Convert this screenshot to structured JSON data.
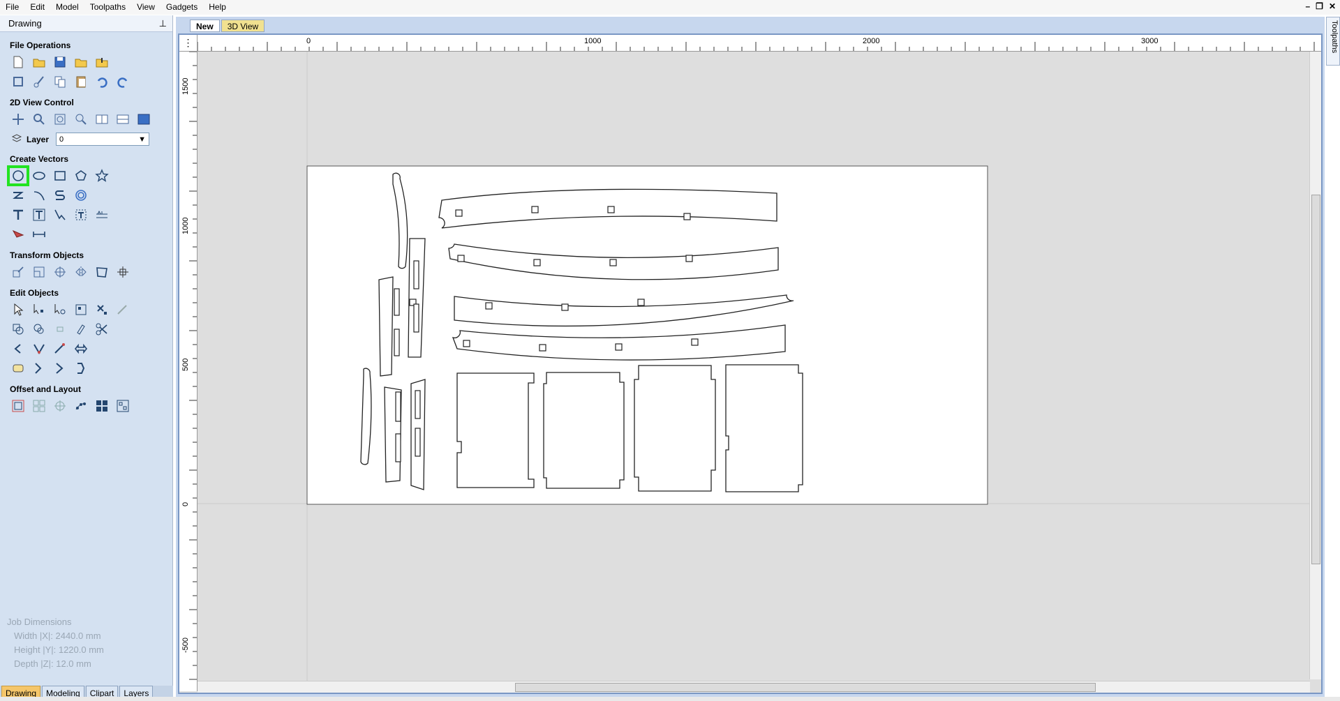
{
  "menu": [
    "File",
    "Edit",
    "Model",
    "Toolpaths",
    "View",
    "Gadgets",
    "Help"
  ],
  "panel": {
    "title": "Drawing",
    "sections": {
      "file_ops": "File Operations",
      "view_control": "2D View Control",
      "create_vectors": "Create Vectors",
      "transform": "Transform Objects",
      "edit": "Edit Objects",
      "offset": "Offset and Layout"
    },
    "layer_label": "Layer",
    "layer_value": "0",
    "job": {
      "title": "Job Dimensions",
      "width": "Width  |X|: 2440.0 mm",
      "height": "Height |Y|: 1220.0 mm",
      "depth": "Depth  |Z|: 12.0 mm"
    },
    "bottom_tabs": [
      "Drawing",
      "Modeling",
      "Clipart",
      "Layers"
    ]
  },
  "view_tabs": [
    "New",
    "3D View"
  ],
  "right_tab": "Toolpaths",
  "ruler": {
    "h": [
      "0",
      "1000",
      "2000",
      "3000"
    ],
    "v": [
      "1500",
      "1000",
      "500",
      "0",
      "-500"
    ]
  },
  "icons": {
    "highlighted": "draw-circle-icon"
  },
  "colors": {
    "highlight": "#22e322",
    "panel_bg": "#d4e1f1"
  }
}
